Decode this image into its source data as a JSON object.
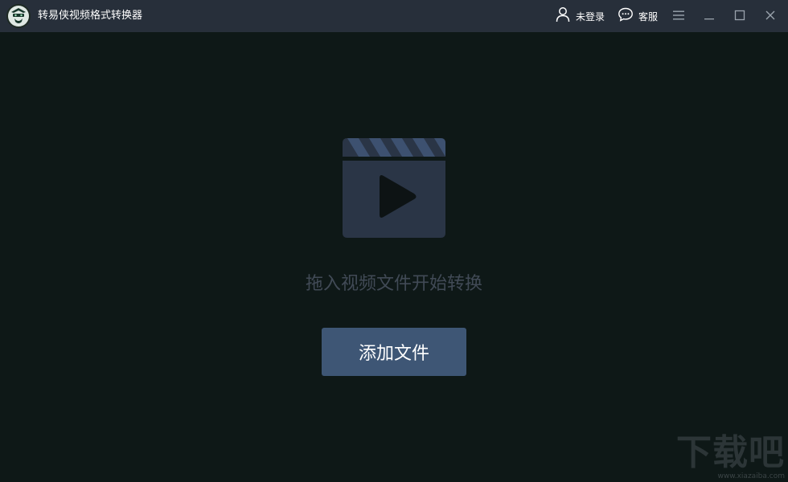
{
  "window": {
    "title": "转易侠视频格式转换器"
  },
  "titlebar": {
    "user_label": "未登录",
    "service_label": "客服"
  },
  "main": {
    "hint": "拖入视频文件开始转换",
    "add_button_label": "添加文件"
  },
  "watermark": {
    "main": "下载吧",
    "sub": "www.xiazaiba.com"
  },
  "colors": {
    "titlebar_bg": "#272f3a",
    "body_bg": "#0e1817",
    "button_bg": "#3e5675",
    "icon_bg": "#2a3546",
    "icon_stripe": "#3d5170",
    "hint_text": "#414a56"
  },
  "icons": {
    "logo": "app-logo",
    "user": "user-icon",
    "service": "chat-bubble-icon",
    "menu": "hamburger-menu-icon",
    "minimize": "minimize-icon",
    "maximize": "maximize-icon",
    "close": "close-icon",
    "drop_area": "video-clapperboard-icon"
  }
}
